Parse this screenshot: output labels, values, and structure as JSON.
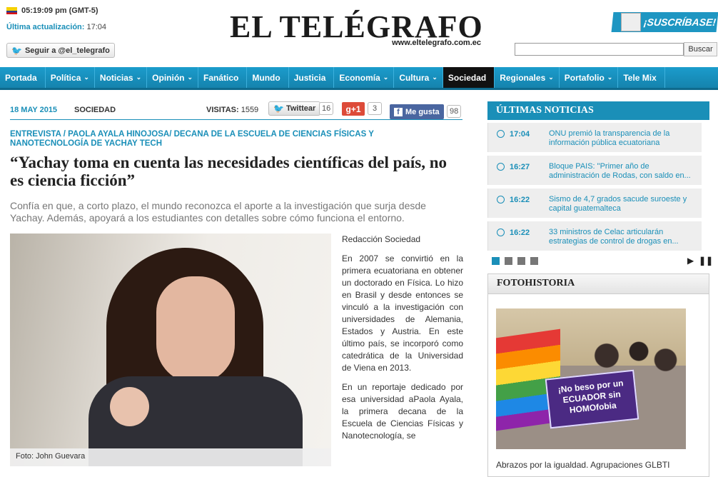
{
  "header": {
    "time": "05:19:09 pm (GMT-5)",
    "updated_label": "Última actualización:",
    "updated_value": "17:04",
    "follow": "Seguir a @el_telegrafo",
    "logo": "EL TELÉGRAFO",
    "logo_url": "www.eltelegrafo.com.ec",
    "subscribe": "¡SUSCRÍBASE!",
    "search_value": "",
    "search_button": "Buscar"
  },
  "nav": [
    {
      "label": "Portada",
      "chev": ""
    },
    {
      "label": "Política",
      "chev": "⌄"
    },
    {
      "label": "Noticias",
      "chev": "⌄"
    },
    {
      "label": "Opinión",
      "chev": "⌄"
    },
    {
      "label": "Fanático",
      "chev": ""
    },
    {
      "label": "Mundo",
      "chev": ""
    },
    {
      "label": "Justicia",
      "chev": ""
    },
    {
      "label": "Economía",
      "chev": "⌄"
    },
    {
      "label": "Cultura",
      "chev": "⌄"
    },
    {
      "label": "Sociedad",
      "chev": ""
    },
    {
      "label": "Regionales",
      "chev": "⌄"
    },
    {
      "label": "Portafolio",
      "chev": "⌄"
    },
    {
      "label": "Tele Mix",
      "chev": ""
    }
  ],
  "article": {
    "date": "18 MAY 2015",
    "section": "SOCIEDAD",
    "visits_label": "VISITAS:",
    "visits": "1559",
    "tweet": "Twittear",
    "tweet_count": "16",
    "gplus": "g+1",
    "gplus_count": "3",
    "like": "Me gusta",
    "like_count": "98",
    "kicker": "ENTREVISTA / PAOLA AYALA HINOJOSA/ DECANA DE LA ESCUELA DE CIENCIAS FÍSICAS Y NANOTECNOLOGÍA DE YACHAY TECH",
    "headline": "“Yachay toma en cuenta las necesidades científicas del país, no es ciencia ficción”",
    "lead": "Confía en que, a corto plazo, el mundo reconozca el aporte a la investigación que surja desde Yachay. Además, apoyará a los estudiantes con detalles sobre cómo funciona el entorno.",
    "photo_caption": "Foto: John Guevara",
    "byline": "Redacción Sociedad",
    "p1": "En 2007 se convirtió en la primera ecuatoriana en obtener un doctorado en Física. Lo hizo en Brasil y desde entonces se vinculó a la investigación con universidades de Alemania, Estados y Austria. En este último país, se incorporó como catedrática de la Universidad de Viena en 2013.",
    "p2": "En un reportaje dedicado por esa universidad aPaola Ayala, la primera decana de la Escuela de Ciencias Físicas y Nanotecnología, se"
  },
  "sidebar": {
    "news_title": "ÚLTIMAS NOTICIAS",
    "news": [
      {
        "time": "17:04",
        "text": "ONU premió la transparencia de la información pública ecuatoriana"
      },
      {
        "time": "16:27",
        "text": "Bloque PAIS: \"Primer año de administración de Rodas, con saldo en..."
      },
      {
        "time": "16:22",
        "text": "Sismo de 4,7 grados sacude suroeste y capital guatemalteca"
      },
      {
        "time": "16:22",
        "text": "33 ministros de Celac articularán estrategias de control de drogas en..."
      }
    ],
    "foto_title": "FOTOHISTORIA",
    "sign_text": "¡No beso por un ECUADOR sin HOMOfobia",
    "foto_caption": "Abrazos por la igualdad. Agrupaciones GLBTI"
  }
}
